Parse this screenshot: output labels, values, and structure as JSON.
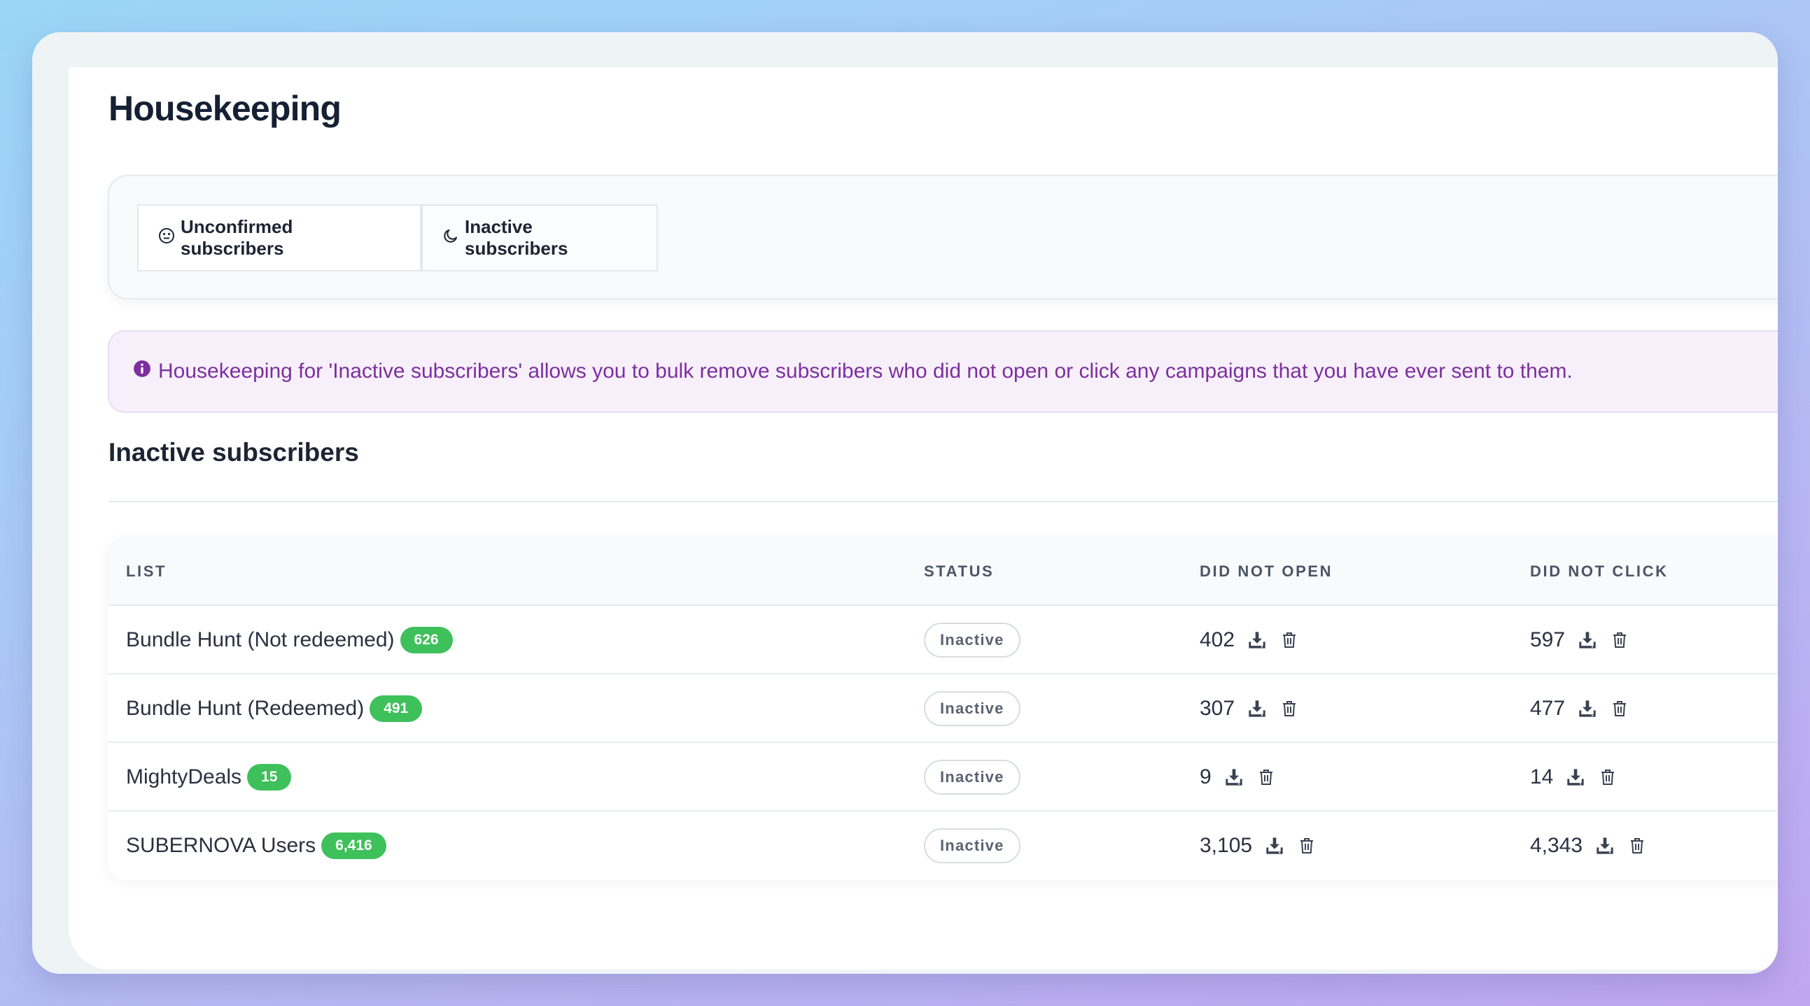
{
  "page": {
    "title": "Housekeeping"
  },
  "tabs": [
    {
      "label": "Unconfirmed subscribers",
      "icon": "neutral-face-icon"
    },
    {
      "label": "Inactive subscribers",
      "icon": "moon-icon"
    }
  ],
  "alert": {
    "icon": "info-icon",
    "text": "Housekeeping for 'Inactive subscribers' allows you to bulk remove subscribers who did not open or click any campaigns that you have ever sent to them.",
    "color": "#7d2f9e"
  },
  "section": {
    "title": "Inactive subscribers"
  },
  "table": {
    "headers": {
      "list": "LIST",
      "status": "STATUS",
      "did_not_open": "DID NOT OPEN",
      "did_not_click": "DID NOT CLICK"
    },
    "rows": [
      {
        "name": "Bundle Hunt (Not redeemed)",
        "count": "626",
        "status": "Inactive",
        "did_not_open": "402",
        "did_not_click": "597"
      },
      {
        "name": "Bundle Hunt (Redeemed)",
        "count": "491",
        "status": "Inactive",
        "did_not_open": "307",
        "did_not_click": "477"
      },
      {
        "name": "MightyDeals",
        "count": "15",
        "status": "Inactive",
        "did_not_open": "9",
        "did_not_click": "14"
      },
      {
        "name": "SUBERNOVA Users",
        "count": "6,416",
        "status": "Inactive",
        "did_not_open": "3,105",
        "did_not_click": "4,343"
      }
    ]
  },
  "colors": {
    "badge": "#3ec05a",
    "title": "#152033"
  }
}
